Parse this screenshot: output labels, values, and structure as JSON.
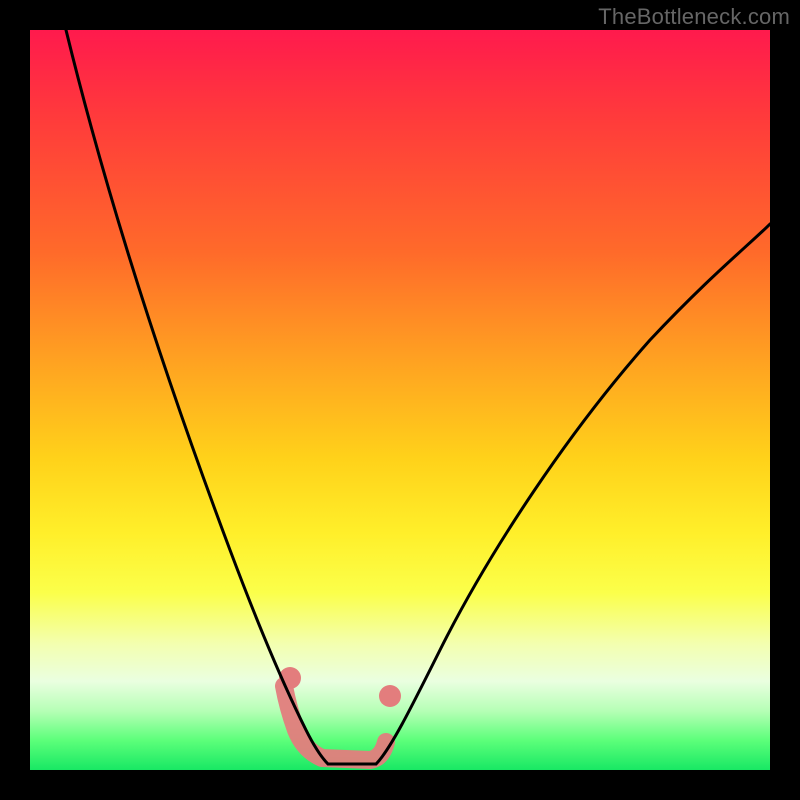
{
  "watermark": "TheBottleneck.com",
  "chart_data": {
    "type": "line",
    "title": "",
    "xlabel": "",
    "ylabel": "",
    "xlim": [
      0,
      100
    ],
    "ylim": [
      0,
      100
    ],
    "grid": false,
    "legend": false,
    "background_gradient": {
      "direction": "vertical",
      "stops": [
        {
          "pos": 0.0,
          "color": "#ff1a4d"
        },
        {
          "pos": 0.3,
          "color": "#ff6a2a"
        },
        {
          "pos": 0.58,
          "color": "#ffd21a"
        },
        {
          "pos": 0.83,
          "color": "#f3ffb0"
        },
        {
          "pos": 0.96,
          "color": "#5cff7a"
        },
        {
          "pos": 1.0,
          "color": "#18e864"
        }
      ]
    },
    "series": [
      {
        "name": "left-arm",
        "x": [
          5,
          10,
          15,
          20,
          25,
          30,
          33,
          35,
          37,
          39
        ],
        "y": [
          100,
          80,
          60,
          42,
          28,
          16,
          10,
          6,
          3,
          0
        ]
      },
      {
        "name": "right-arm",
        "x": [
          47,
          50,
          55,
          60,
          65,
          70,
          80,
          90,
          100
        ],
        "y": [
          0,
          4,
          12,
          22,
          32,
          41,
          55,
          66,
          74
        ]
      },
      {
        "name": "valley-floor",
        "x": [
          39,
          42,
          44,
          46,
          47
        ],
        "y": [
          0,
          0,
          0,
          0,
          0
        ]
      }
    ],
    "highlight_region": {
      "description": "pink thick arc marking the bottleneck valley",
      "x": [
        35,
        37,
        39,
        41,
        43,
        45,
        47,
        48
      ],
      "y": [
        11,
        5,
        1,
        0,
        0,
        0,
        1,
        5
      ]
    },
    "highlight_dots": [
      {
        "x": 36,
        "y": 9
      },
      {
        "x": 49,
        "y": 9
      }
    ]
  }
}
